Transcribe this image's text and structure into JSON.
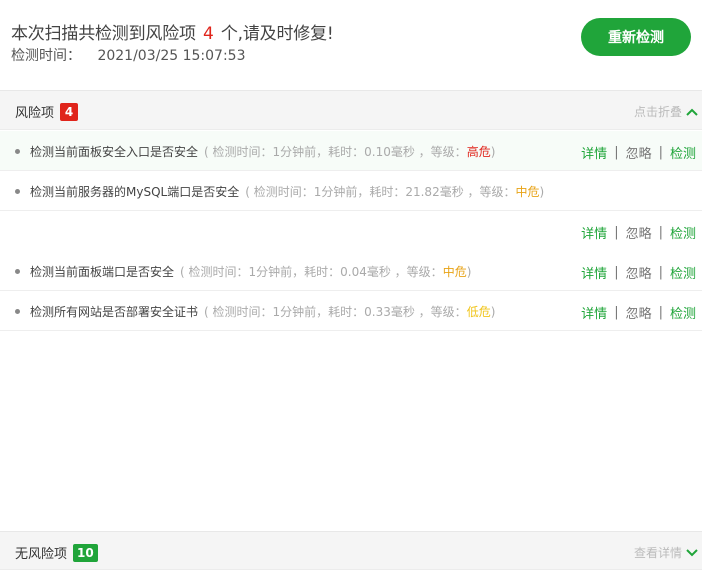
{
  "header": {
    "summary_prefix": "本次扫描共检测到风险项",
    "risk_count": "4",
    "summary_suffix": "个,请及时修复!",
    "scan_time_label": "检测时间：",
    "scan_time_value": "2021/03/25 15:07:53",
    "rescan_label": "重新检测"
  },
  "risk_section": {
    "title": "风险项",
    "count": "4",
    "toggle_label": "点击折叠"
  },
  "items": [
    {
      "title": "检测当前面板安全入口是否安全",
      "meta": "( 检测时间：1分钟前，耗时：0.10毫秒 ，等级：",
      "level": "高危",
      "close": ")"
    },
    {
      "title": "检测当前服务器的MySQL端口是否安全",
      "meta": "( 检测时间：1分钟前，耗时：21.82毫秒 ，等级：",
      "level": "中危",
      "close": ")"
    },
    {
      "title": "检测当前面板端口是否安全",
      "meta": "( 检测时间：1分钟前，耗时：0.04毫秒 ，等级：",
      "level": "中危",
      "close": ")"
    },
    {
      "title": "检测所有网站是否部署安全证书",
      "meta": "( 检测时间：1分钟前，耗时：0.33毫秒 ，等级：",
      "level": "低危",
      "close": ")"
    }
  ],
  "actions": {
    "detail": "详情",
    "ignore": "忽略",
    "check": "检测",
    "sep": "|"
  },
  "norisk_section": {
    "title": "无风险项",
    "count": "10",
    "toggle_label": "查看详情"
  },
  "colors": {
    "accent": "#20a53a",
    "high": "#e0241b",
    "medium": "#e8a317",
    "low": "#f0c419"
  }
}
